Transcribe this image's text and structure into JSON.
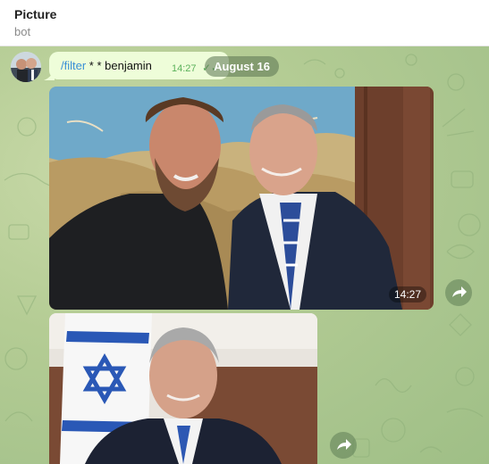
{
  "header": {
    "title": "Picture",
    "subtitle": "bot"
  },
  "message": {
    "command": "/filter",
    "args": " * * benjamin",
    "time": "14:27",
    "status": "✓✓"
  },
  "date_pill": "August 16",
  "photos": [
    {
      "time": "14:27",
      "forward_icon": "share-arrow-icon"
    },
    {
      "forward_icon": "share-arrow-icon"
    }
  ],
  "colors": {
    "bubble": "#eefdd9",
    "command_link": "#3a8fd6",
    "time_green": "#5bb15b",
    "chat_bg": "#b4cc94"
  }
}
